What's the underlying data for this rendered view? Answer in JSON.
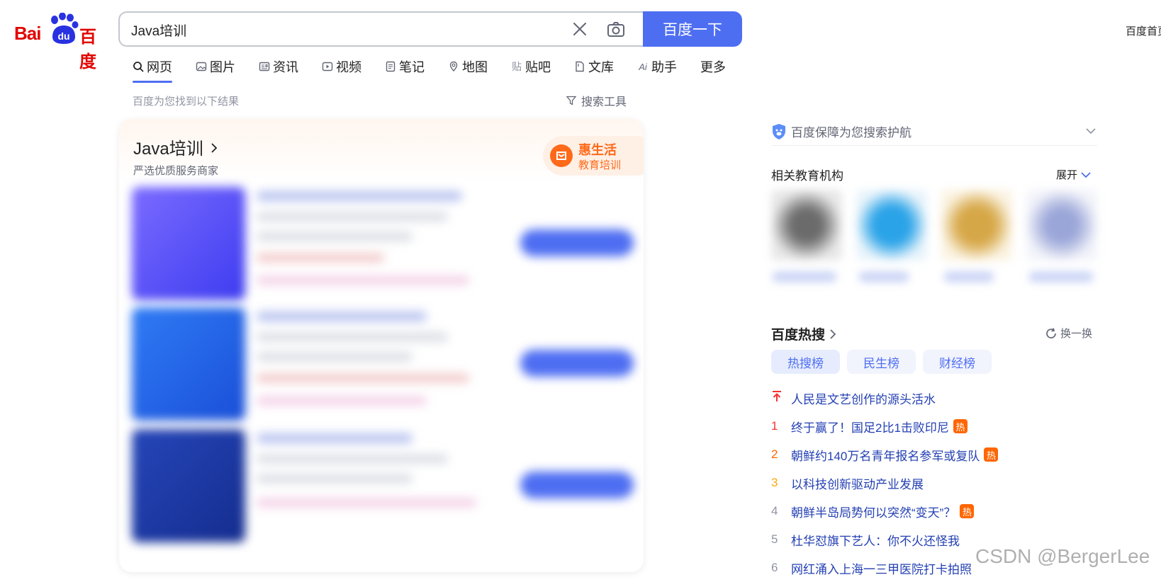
{
  "logo": {
    "text_en": "Bai",
    "text_du": "du",
    "text_cn": "百度"
  },
  "search": {
    "value": "Java培训",
    "button_label": "百度一下"
  },
  "header": {
    "home_link": "百度首页"
  },
  "tabs": [
    {
      "label": "网页",
      "icon": "search-icon"
    },
    {
      "label": "图片",
      "icon": "image-icon"
    },
    {
      "label": "资讯",
      "icon": "news-icon"
    },
    {
      "label": "视频",
      "icon": "video-icon"
    },
    {
      "label": "笔记",
      "icon": "note-icon"
    },
    {
      "label": "地图",
      "icon": "map-icon"
    },
    {
      "label": "贴吧",
      "icon": "tieba-icon"
    },
    {
      "label": "文库",
      "icon": "wenku-icon"
    },
    {
      "label": "助手",
      "icon": "ai-icon"
    },
    {
      "label": "更多",
      "icon": ""
    }
  ],
  "results_meta": {
    "count_text": "百度为您找到以下结果",
    "tools_label": "搜索工具"
  },
  "card": {
    "title": "Java培训",
    "subtitle": "严选优质服务商家",
    "badge_name": "惠生活",
    "badge_desc": "教育培训"
  },
  "sidebar": {
    "protect_text": "百度保障为您搜索护航",
    "related_title": "相关教育机构",
    "related_expand": "展开",
    "hot_title": "百度热搜",
    "hot_refresh": "换一换",
    "hot_tabs": [
      "热搜榜",
      "民生榜",
      "财经榜"
    ],
    "hot_items": [
      {
        "rank": "",
        "text": "人民是文艺创作的源头活水",
        "badge": ""
      },
      {
        "rank": "1",
        "text": "终于赢了！国足2比1击败印尼",
        "badge": "热"
      },
      {
        "rank": "2",
        "text": "朝鲜约140万名青年报名参军或复队",
        "badge": "热"
      },
      {
        "rank": "3",
        "text": "以科技创新驱动产业发展",
        "badge": ""
      },
      {
        "rank": "4",
        "text": "朝鲜半岛局势何以突然“变天”？",
        "badge": "热"
      },
      {
        "rank": "5",
        "text": "杜华怼旗下艺人：你不火还怪我",
        "badge": ""
      },
      {
        "rank": "6",
        "text": "网红涌入上海一三甲医院打卡拍照",
        "badge": ""
      }
    ]
  },
  "watermark": "CSDN @BergerLee",
  "colors": {
    "brand_blue": "#4e6ef2",
    "baidu_red": "#e10602",
    "hot_orange": "#ff6600"
  }
}
